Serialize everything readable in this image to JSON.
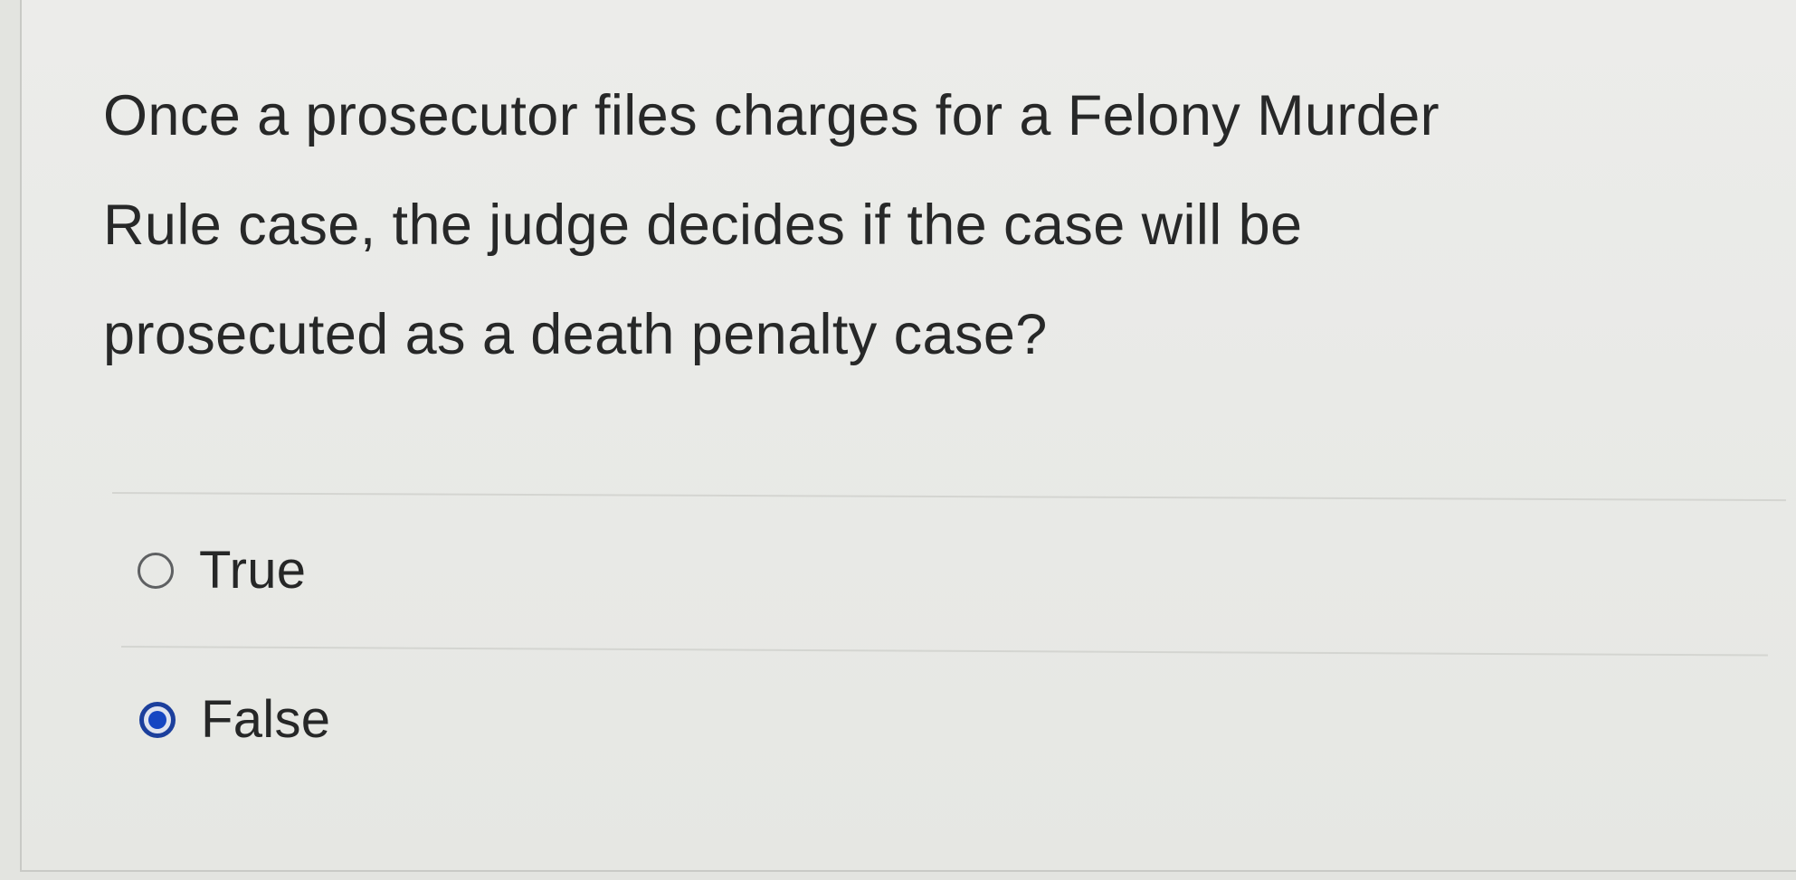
{
  "question": {
    "line1": "Once a prosecutor files charges for a Felony Murder",
    "line2": "Rule case, the judge decides if the case will be",
    "line3": "prosecuted as a death penalty case?"
  },
  "options": [
    {
      "label": "True",
      "selected": false
    },
    {
      "label": "False",
      "selected": true
    }
  ],
  "colors": {
    "selected_radio": "#1646c2",
    "text": "#272828",
    "background": "#e9eae7"
  },
  "icons": {
    "unselected": "radio-unchecked-icon",
    "selected": "radio-checked-icon"
  }
}
